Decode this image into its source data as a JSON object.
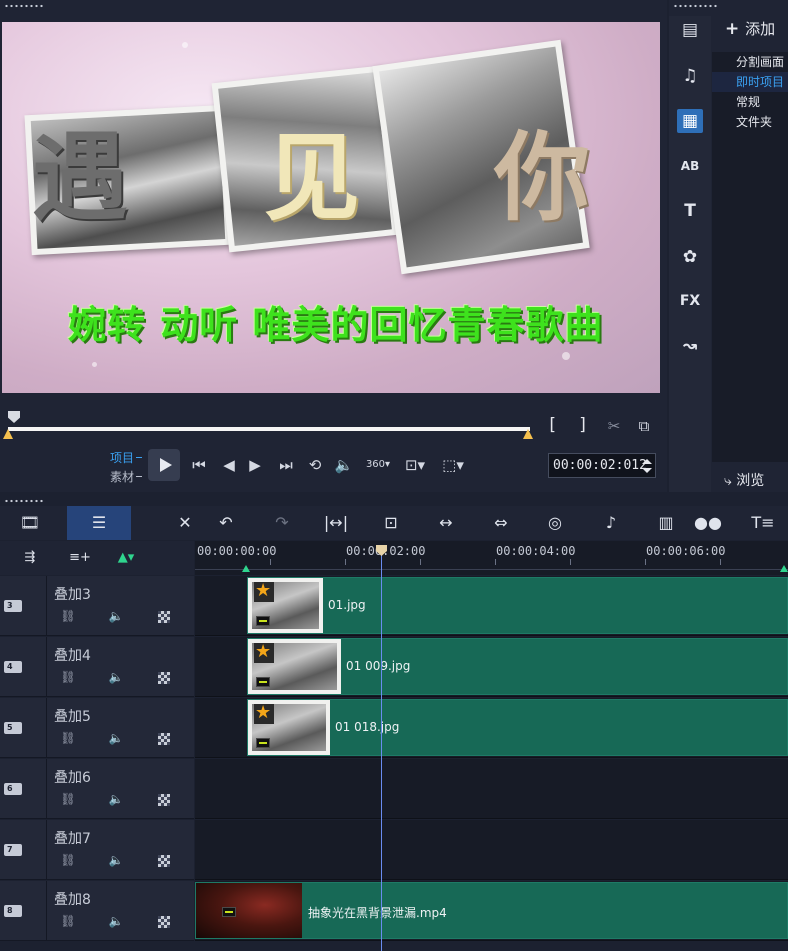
{
  "player": {
    "title_chars": [
      "遇",
      "见",
      "你"
    ],
    "subtitle": "婉转 动听 唯美的回忆青春歌曲",
    "mode_project": "项目",
    "mode_clip": "素材",
    "timecode": "00:00:02:012",
    "in_bracket": "[",
    "out_bracket": "]",
    "scrub_position": 0.0
  },
  "library": {
    "add_label": "添加",
    "items": [
      "分割画面",
      "即时项目",
      "常规",
      "文件夹"
    ],
    "selected_index": 1,
    "browse_label": "浏览"
  },
  "timeline": {
    "ruler_labels": [
      "00:00:00:00",
      "00:00:02:00",
      "00:00:04:00",
      "00:00:06:00"
    ],
    "tracks": [
      {
        "num": "3",
        "name": "叠加3",
        "clip": "01.jpg"
      },
      {
        "num": "4",
        "name": "叠加4",
        "clip": "01 009.jpg"
      },
      {
        "num": "5",
        "name": "叠加5",
        "clip": "01 018.jpg"
      },
      {
        "num": "6",
        "name": "叠加6",
        "clip": ""
      },
      {
        "num": "7",
        "name": "叠加7",
        "clip": ""
      },
      {
        "num": "8",
        "name": "叠加8",
        "clip": "抽象光在黑背景泄漏.mp4"
      }
    ]
  },
  "colors": {
    "accent_blue": "#3aa0f0",
    "clip_green": "#176956",
    "title_green": "#3ee21d",
    "trim_marker": "#f5c04e"
  }
}
